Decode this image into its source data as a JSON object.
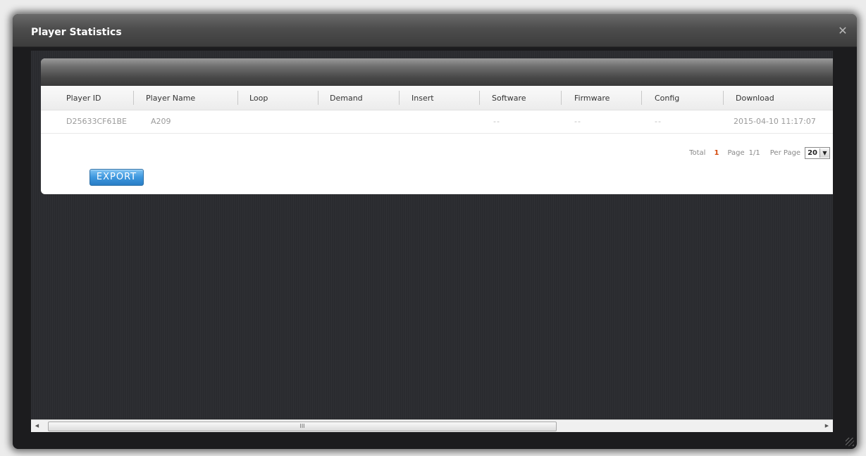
{
  "dialog": {
    "title": "Player Statistics",
    "close_icon": "close-icon"
  },
  "table": {
    "columns": [
      "Player ID",
      "Player Name",
      "Loop",
      "Demand",
      "Insert",
      "Software",
      "Firmware",
      "Config",
      "Download"
    ],
    "rows": [
      {
        "player_id": "D25633CF61BE",
        "player_name": "A209",
        "loop": "",
        "demand": "",
        "insert": "",
        "software": "--",
        "firmware": "--",
        "config": "--",
        "download": "2015-04-10 11:17:07"
      }
    ]
  },
  "pager": {
    "total_label": "Total",
    "total_value": "1",
    "page_label": "Page",
    "page_value": "1/1",
    "per_page_label": "Per Page",
    "per_page_value": "20"
  },
  "actions": {
    "export_label": "EXPORT"
  },
  "scrollbar": {
    "grip": "III"
  },
  "colors": {
    "accent": "#3d97de",
    "total_highlight": "#d44a0c"
  }
}
